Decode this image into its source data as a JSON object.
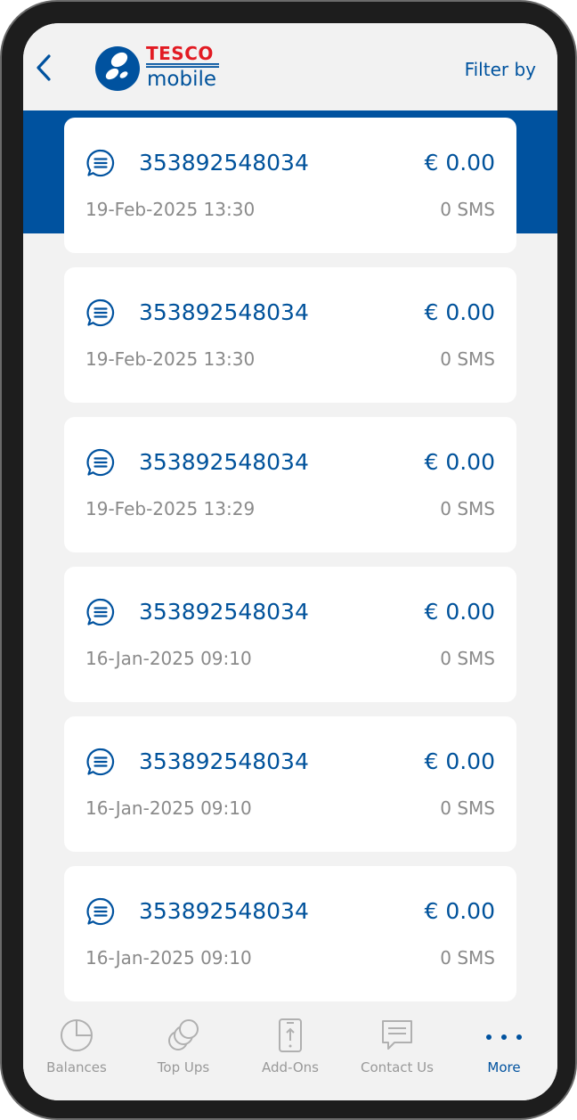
{
  "header": {
    "logo_brand": "TESCO",
    "logo_product": "mobile",
    "filter_label": "Filter by"
  },
  "items": [
    {
      "number": "353892548034",
      "amount": "€ 0.00",
      "date": "19-Feb-2025 13:30",
      "usage": "0 SMS"
    },
    {
      "number": "353892548034",
      "amount": "€ 0.00",
      "date": "19-Feb-2025 13:30",
      "usage": "0 SMS"
    },
    {
      "number": "353892548034",
      "amount": "€ 0.00",
      "date": "19-Feb-2025 13:29",
      "usage": "0 SMS"
    },
    {
      "number": "353892548034",
      "amount": "€ 0.00",
      "date": "16-Jan-2025 09:10",
      "usage": "0 SMS"
    },
    {
      "number": "353892548034",
      "amount": "€ 0.00",
      "date": "16-Jan-2025 09:10",
      "usage": "0 SMS"
    },
    {
      "number": "353892548034",
      "amount": "€ 0.00",
      "date": "16-Jan-2025 09:10",
      "usage": "0 SMS"
    }
  ],
  "tabs": [
    {
      "label": "Balances",
      "icon": "pie-chart-icon"
    },
    {
      "label": "Top Ups",
      "icon": "coins-icon"
    },
    {
      "label": "Add-Ons",
      "icon": "phone-upload-icon"
    },
    {
      "label": "Contact Us",
      "icon": "chat-bubble-icon"
    },
    {
      "label": "More",
      "icon": "more-dots-icon"
    }
  ],
  "colors": {
    "brand_blue": "#00529f",
    "brand_red": "#e21b23",
    "muted_text": "#8a8a8a",
    "background": "#f2f2f2"
  }
}
